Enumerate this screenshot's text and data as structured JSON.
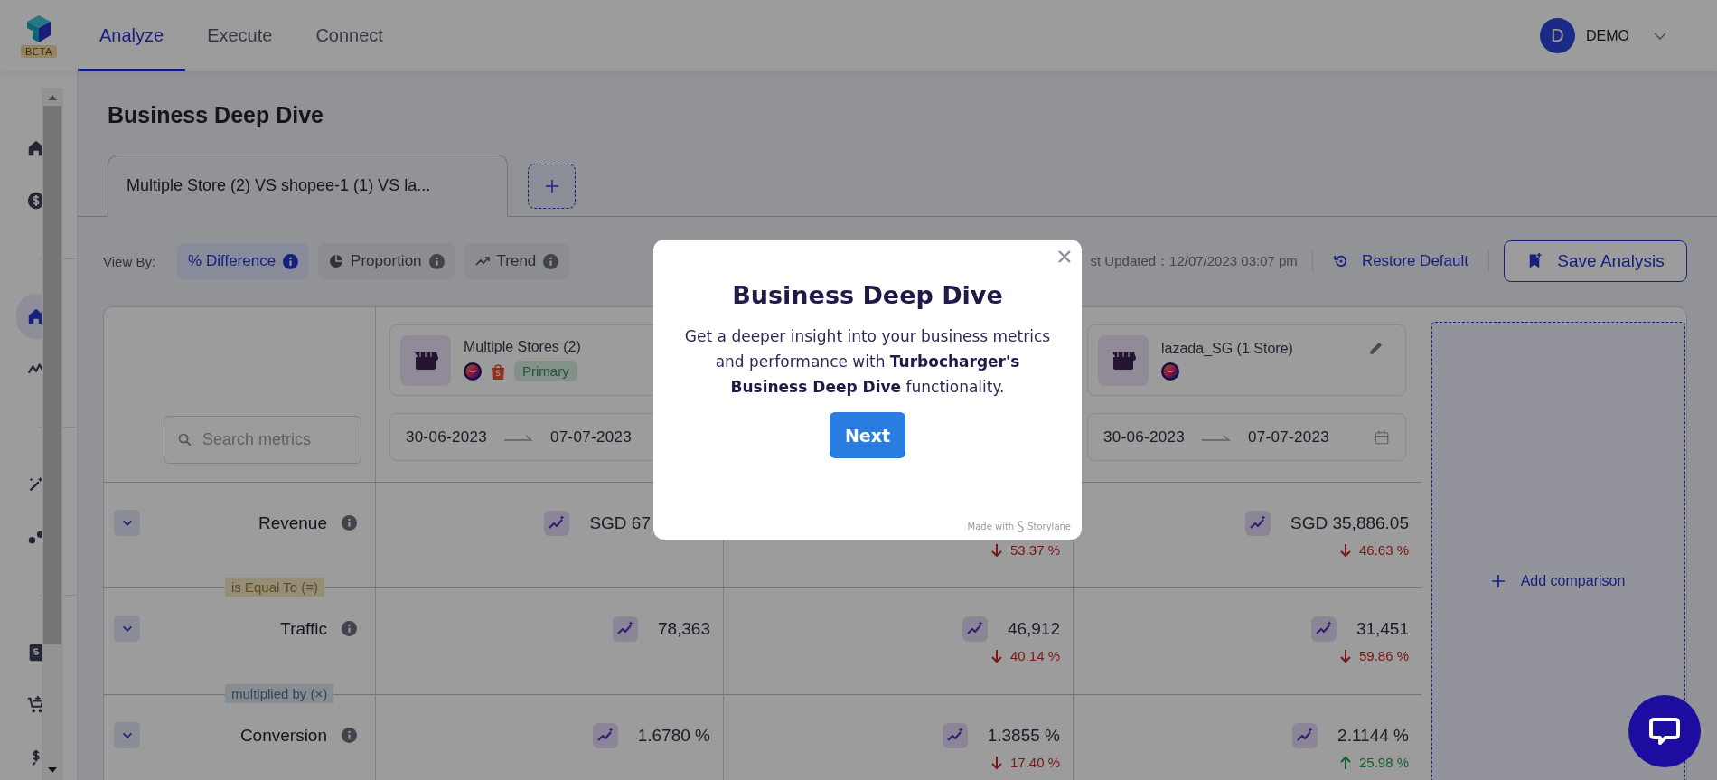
{
  "app": {
    "beta_badge": "BETA"
  },
  "nav_tabs": [
    {
      "label": "Analyze",
      "selected": true
    },
    {
      "label": "Execute",
      "selected": false
    },
    {
      "label": "Connect",
      "selected": false
    }
  ],
  "user": {
    "initial": "D",
    "name": "DEMO"
  },
  "sidebar": {
    "items": [
      {
        "kind": "home",
        "selected": false
      },
      {
        "kind": "dollar",
        "selected": false
      },
      {
        "kind": "divider"
      },
      {
        "kind": "home",
        "selected": true
      },
      {
        "kind": "chart",
        "selected": false
      },
      {
        "kind": "divider"
      },
      {
        "kind": "wand",
        "selected": false
      },
      {
        "kind": "dots",
        "selected": false
      },
      {
        "kind": "divider"
      },
      {
        "kind": "invoice",
        "selected": false
      },
      {
        "kind": "cart",
        "selected": false
      },
      {
        "kind": "money",
        "selected": false
      }
    ]
  },
  "page_title": "Business Deep Dive",
  "analysis_tabs": [
    {
      "label": "Multiple Store (2) VS shopee-1 (1) VS la...",
      "selected": true
    }
  ],
  "view_by": {
    "label": "View By:",
    "options": [
      {
        "kind": "difference",
        "label": "% Difference",
        "selected": true
      },
      {
        "kind": "proportion",
        "label": "Proportion",
        "selected": false
      },
      {
        "kind": "trend",
        "label": "Trend",
        "selected": false
      }
    ]
  },
  "last_updated": "st Updated：12/07/2023 03:07 pm",
  "restore_button": "Restore Default",
  "save_button": "Save Analysis",
  "search": {
    "placeholder": "Search metrics"
  },
  "columns": [
    {
      "header": {
        "name": "Multiple Stores (2)",
        "platforms": [
          {
            "kind": "lazada"
          },
          {
            "kind": "shopee"
          }
        ],
        "tag": "Primary",
        "editable": false
      },
      "dates": {
        "start": "30-06-2023",
        "end": "07-07-2023",
        "calendar": false
      }
    },
    {},
    {
      "header": {
        "name": "lazada_SG (1 Store)",
        "platforms": [
          {
            "kind": "lazada"
          }
        ],
        "editable": true
      },
      "dates": {
        "start": "30-06-2023",
        "end": "07-07-2023",
        "calendar": true
      }
    }
  ],
  "add_comparison": "Add comparison",
  "metrics": [
    {
      "name": "Revenue",
      "cells": [
        {
          "value": "SGD 67",
          "partial": true
        },
        {
          "change": "53.37 %",
          "rising": false
        },
        {
          "value": "SGD 35,886.05",
          "change": "46.63 %",
          "rising": false
        }
      ]
    },
    {
      "name": "Traffic",
      "operator": {
        "kind": "equals",
        "label": "is Equal To (=)"
      },
      "cells": [
        {
          "value": "78,363"
        },
        {
          "value": "46,912",
          "change": "40.14 %",
          "rising": false
        },
        {
          "value": "31,451",
          "change": "59.86 %",
          "rising": false
        }
      ]
    },
    {
      "name": "Conversion",
      "operator": {
        "kind": "multiply",
        "label": "multiplied by (×)"
      },
      "cells": [
        {
          "value": "1.6780 %"
        },
        {
          "value": "1.3855 %",
          "change": "17.40 %",
          "rising": false
        },
        {
          "value": "2.1144 %",
          "change": "25.98 %",
          "rising": true
        }
      ]
    }
  ],
  "modal": {
    "title": "Business Deep Dive",
    "body": "Get a deeper insight into your business metrics and performance with **Turbocharger's Business Deep Dive** functionality.",
    "button": "Next",
    "footer_prefix": "Made with",
    "footer_brand": "Storylane"
  }
}
